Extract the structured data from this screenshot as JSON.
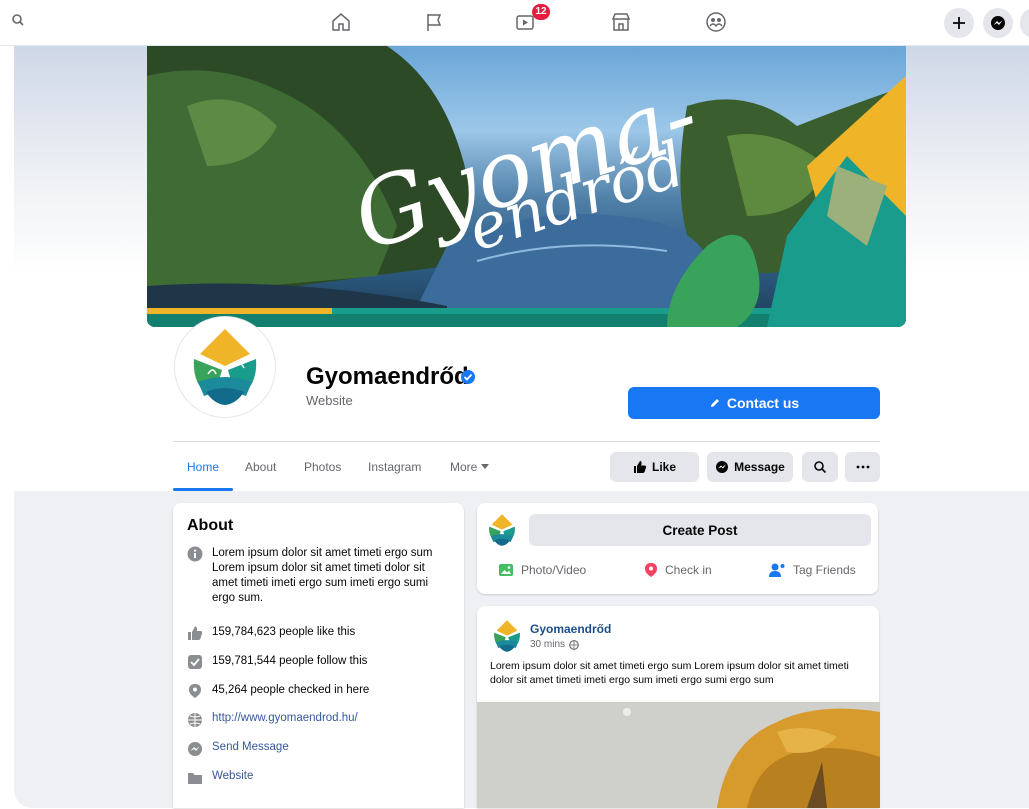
{
  "topbar": {
    "icons": [
      "search-icon",
      "home-icon",
      "pages-flag-icon",
      "watch-video-icon",
      "marketplace-icon",
      "groups-icon"
    ],
    "watch_badge": "12",
    "right_buttons": [
      "plus-icon",
      "messenger-icon"
    ]
  },
  "cover": {
    "script_title": "Gyoma-endrőd"
  },
  "profile": {
    "name": "Gyomaendrőd",
    "category": "Website",
    "verified": true,
    "contact_button": "Contact us"
  },
  "tabs": [
    {
      "label": "Home",
      "active": true
    },
    {
      "label": "About"
    },
    {
      "label": "Photos"
    },
    {
      "label": "Instagram"
    },
    {
      "label": "More"
    }
  ],
  "actions": {
    "like": "Like",
    "message": "Message"
  },
  "about": {
    "title": "About",
    "description": "Lorem ipsum dolor sit amet timeti ergo sum Lorem ipsum dolor sit amet timeti dolor sit amet timeti imeti ergo sum imeti ergo sumi ergo sum.",
    "likes": "159,784,623 people like this",
    "follows": "159,781,544 people follow this",
    "checkins": "45,264 people checked in here",
    "website_url": "http://www.gyomaendrod.hu/",
    "send_message": "Send Message",
    "website": "Website"
  },
  "create_post": {
    "button": "Create Post",
    "photo_video": "Photo/Video",
    "check_in": "Check in",
    "tag_friends": "Tag Friends"
  },
  "post": {
    "author": "Gyomaendrőd",
    "time": "30 mins",
    "text": "Lorem ipsum dolor sit amet timeti ergo sum Lorem ipsum dolor sit amet timeti dolor sit amet timeti imeti ergo sum imeti ergo sumi ergo sum"
  },
  "colors": {
    "brand_blue": "#1877f2",
    "badge_red": "#e41e3f",
    "logo_orange": "#f0b429",
    "logo_green": "#3aa35b",
    "logo_teal": "#1a9c8c"
  }
}
